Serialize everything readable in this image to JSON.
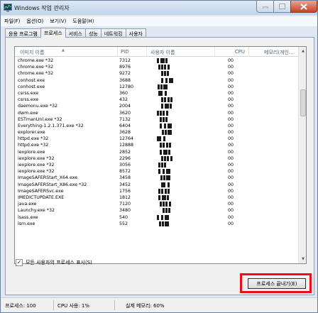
{
  "window": {
    "title": "Windows 작업 관리자"
  },
  "menu": [
    "파일(F)",
    "옵션(O)",
    "보기(V)",
    "도움말(H)"
  ],
  "tabs": [
    {
      "label": "응용 프로그램",
      "active": false
    },
    {
      "label": "프로세스",
      "active": true
    },
    {
      "label": "서비스",
      "active": false
    },
    {
      "label": "성능",
      "active": false
    },
    {
      "label": "네트워킹",
      "active": false
    },
    {
      "label": "사용자",
      "active": false
    }
  ],
  "columns": {
    "name": "이미지 이름",
    "pid": "PID",
    "user": "사용자 이름",
    "cpu": "CPU",
    "memory": "메모리(개인..."
  },
  "processes": [
    {
      "name": "chrome.exe *32",
      "pid": "7312",
      "cpu": "00"
    },
    {
      "name": "chrome.exe *32",
      "pid": "8976",
      "cpu": "00"
    },
    {
      "name": "chrome.exe *32",
      "pid": "9272",
      "cpu": "00"
    },
    {
      "name": "conhost.exe",
      "pid": "3688",
      "cpu": "00"
    },
    {
      "name": "conhost.exe",
      "pid": "12780",
      "cpu": "00"
    },
    {
      "name": "csrss.exe",
      "pid": "360",
      "cpu": "00"
    },
    {
      "name": "csrss.exe",
      "pid": "432",
      "cpu": "00"
    },
    {
      "name": "daemonu.exe *32",
      "pid": "2004",
      "cpu": "00"
    },
    {
      "name": "dwm.exe",
      "pid": "3620",
      "cpu": "00"
    },
    {
      "name": "ESTmanUnl.exe *32",
      "pid": "7132",
      "cpu": "00"
    },
    {
      "name": "Everything-1.2.1.371.exe *32",
      "pid": "6404",
      "cpu": "00"
    },
    {
      "name": "explorer.exe",
      "pid": "3628",
      "cpu": "00"
    },
    {
      "name": "httpd.exe *32",
      "pid": "12764",
      "cpu": "00"
    },
    {
      "name": "httpd.exe *32",
      "pid": "12888",
      "cpu": "00"
    },
    {
      "name": "iexplore.exe",
      "pid": "2852",
      "cpu": "00"
    },
    {
      "name": "iexplore.exe *32",
      "pid": "2296",
      "cpu": "00"
    },
    {
      "name": "iexplore.exe *32",
      "pid": "3056",
      "cpu": "00"
    },
    {
      "name": "iexplore.exe *32",
      "pid": "8572",
      "cpu": "00"
    },
    {
      "name": "ImageSAFERStart_X64.exe",
      "pid": "3458",
      "cpu": "00"
    },
    {
      "name": "ImageSAFERStart_X86.exe *32",
      "pid": "3452",
      "cpu": "00"
    },
    {
      "name": "ImageSAFERSvc.exe",
      "pid": "1756",
      "cpu": "00"
    },
    {
      "name": "IMEDICTUPDATE.EXE",
      "pid": "1812",
      "cpu": "00"
    },
    {
      "name": "java.exe",
      "pid": "7120",
      "cpu": "00"
    },
    {
      "name": "Launchy.exe *32",
      "pid": "3480",
      "cpu": "00"
    },
    {
      "name": "lsass.exe",
      "pid": "540",
      "cpu": "00"
    },
    {
      "name": "lsm.exe",
      "pid": "552",
      "cpu": "00"
    }
  ],
  "show_all_users": {
    "label": "모든 사용자의 프로세스 표시(S)",
    "checked": true
  },
  "end_process_button": "프로세스 끝내기(E)",
  "status": {
    "processes": "프로세스: 100",
    "cpu": "CPU 사용: 1%",
    "memory": "실제 메모리: 60%"
  },
  "colors": {
    "highlight": "#e8101c",
    "titlebar": "#c2d5ea",
    "close_button": "#c4432a"
  }
}
